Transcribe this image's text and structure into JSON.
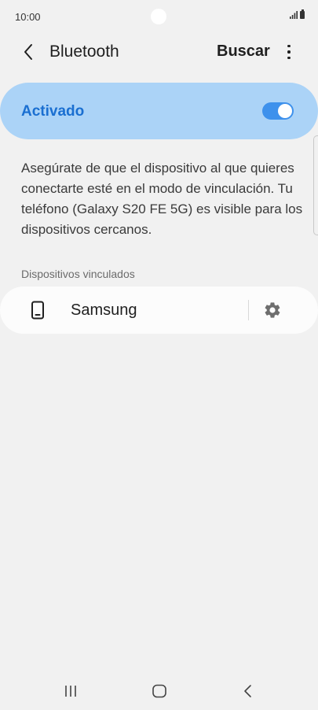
{
  "status_bar": {
    "time": "10:00",
    "icons": [
      "signal-icon",
      "battery-icon"
    ]
  },
  "app_bar": {
    "title": "Bluetooth",
    "search_label": "Buscar",
    "icons": [
      "back-arrow-icon",
      "more-vertical-icon"
    ]
  },
  "master_switch": {
    "label": "Activado",
    "state": "on",
    "accent_color": "#3e91ec",
    "card_color": "#abd3f7",
    "label_color": "#1a6fd1"
  },
  "description": "Asegúrate de que el dispositivo al que quieres conectarte esté en el modo de vinculación. Tu teléfono (Galaxy S20 FE 5G) es visible para los dispositivos cercanos.",
  "paired_section": {
    "header": "Dispositivos vinculados",
    "devices": [
      {
        "name": "Samsung",
        "icon": "phone-icon",
        "action_icon": "gear-icon"
      }
    ]
  },
  "nav_bar": {
    "icons": [
      "recent-apps-icon",
      "home-icon",
      "back-icon"
    ]
  }
}
